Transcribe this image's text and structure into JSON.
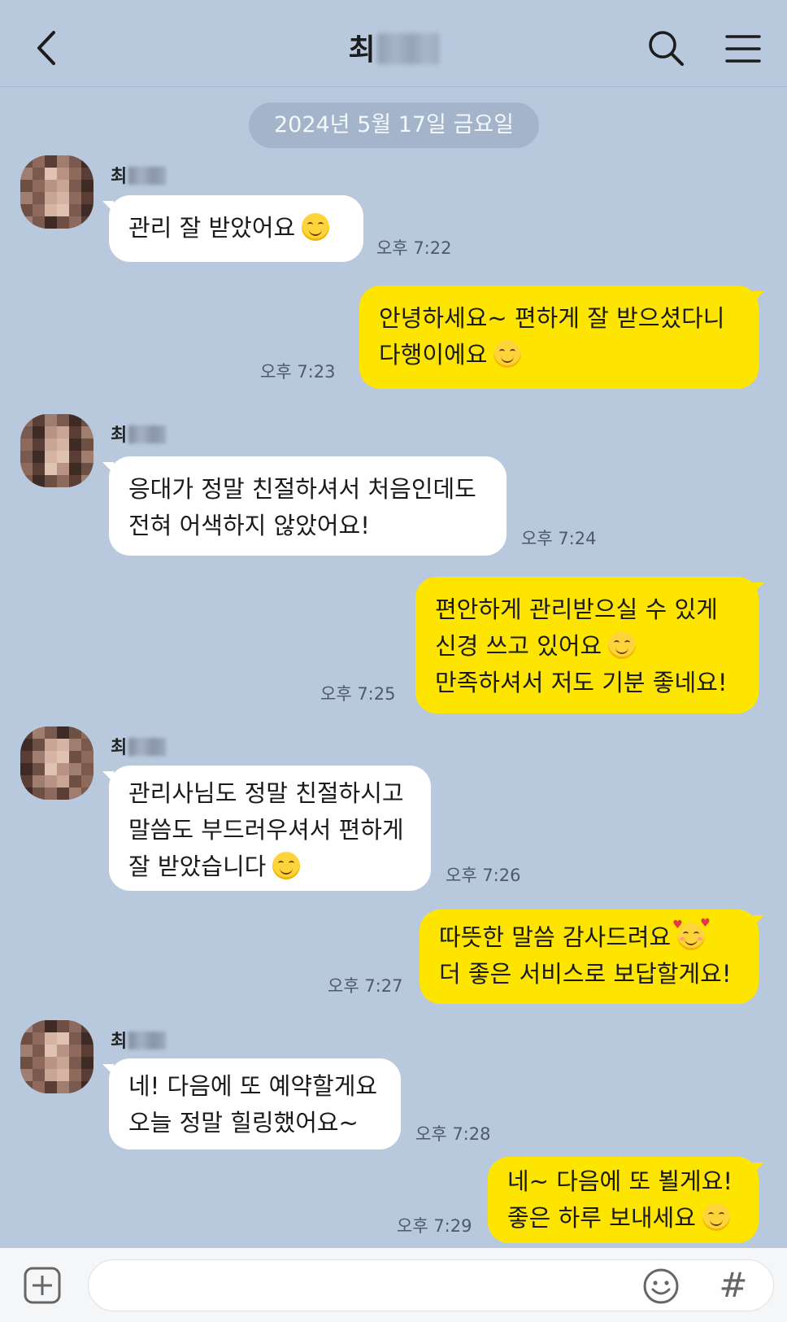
{
  "header": {
    "title": "최",
    "back_icon": "chevron-left-icon",
    "search_icon": "search-icon",
    "menu_icon": "hamburger-menu-icon"
  },
  "date_divider": "2024년 5월 17일 금요일",
  "messages": [
    {
      "side": "in",
      "sender": "최",
      "lines": [
        "관리 잘 받았어요"
      ],
      "emoji": "smiling-face",
      "time": "오후 7:22"
    },
    {
      "side": "out",
      "lines": [
        "안녕하세요~ 편하게 잘 받으셨다니",
        "다행이에요"
      ],
      "emoji": "smiling-face",
      "time": "오후 7:23"
    },
    {
      "side": "in",
      "sender": "최",
      "lines": [
        "응대가 정말 친절하셔서 처음인데도",
        "전혀 어색하지 않았어요!"
      ],
      "time": "오후 7:24"
    },
    {
      "side": "out",
      "lines": [
        "편안하게 관리받으실 수 있게",
        "신경 쓰고 있어요",
        "만족하셔서 저도 기분 좋네요!"
      ],
      "emoji": "smiling-face",
      "time": "오후 7:25"
    },
    {
      "side": "in",
      "sender": "최",
      "lines": [
        "관리사님도 정말 친절하시고",
        "말씀도 부드러우셔서 편하게",
        "잘 받았습니다"
      ],
      "emoji": "smiling-face",
      "time": "오후 7:26"
    },
    {
      "side": "out",
      "lines": [
        "따뜻한 말씀 감사드려요",
        "더 좋은 서비스로 보답할게요!"
      ],
      "emoji": "smiling-face-with-hearts",
      "time": "오후 7:27"
    },
    {
      "side": "in",
      "sender": "최",
      "lines": [
        "네! 다음에 또 예약할게요",
        "오늘 정말 힐링했어요~"
      ],
      "time": "오후 7:28"
    },
    {
      "side": "out",
      "lines": [
        "네~ 다음에 또 뵐게요!",
        "좋은 하루 보내세요"
      ],
      "emoji": "smiling-face",
      "time": "오후 7:29"
    }
  ],
  "input_bar": {
    "plus_icon": "plus-square-icon",
    "input_value": "",
    "emoji_icon": "smiley-icon",
    "hash_label": "#"
  },
  "colors": {
    "background": "#b8c8dd",
    "incoming_bubble": "#ffffff",
    "outgoing_bubble": "#fee500"
  }
}
